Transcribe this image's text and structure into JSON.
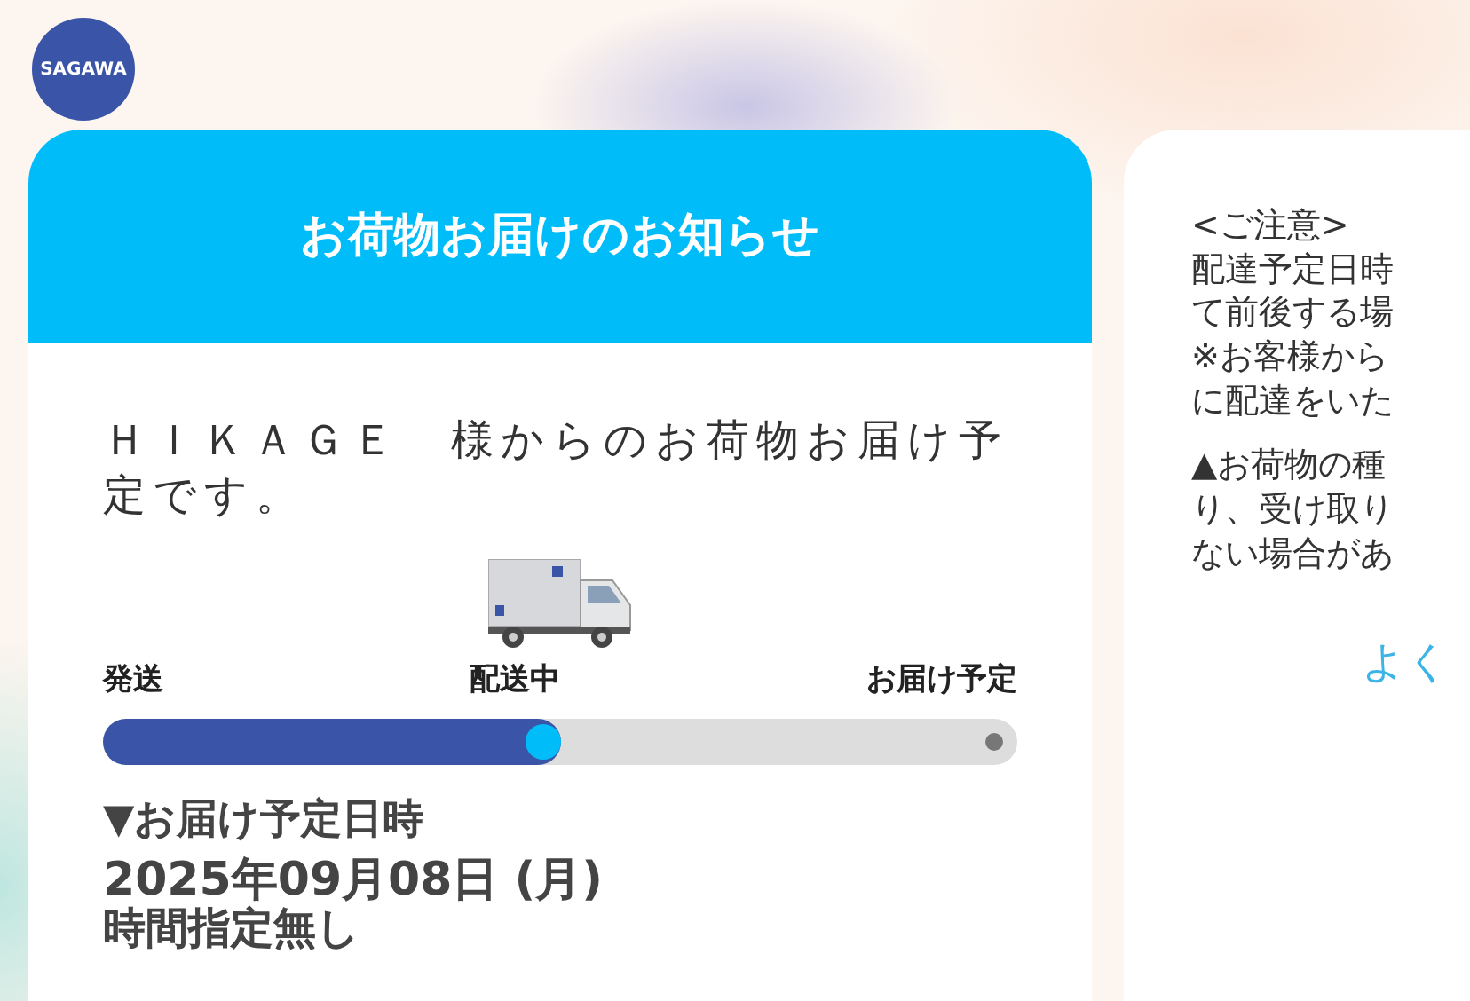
{
  "logo": {
    "text": "SAGAWA"
  },
  "main_card": {
    "title": "お荷物お届けのお知らせ",
    "message": "ＨＩＫＡＧＥ　様からのお荷物お届け予定です。",
    "progress": {
      "steps": [
        {
          "label": "発送"
        },
        {
          "label": "配送中"
        },
        {
          "label": "お届け予定"
        }
      ],
      "level": 0.5
    },
    "delivery_heading": "▼お届け予定日時",
    "delivery_date": "2025年09月08日 (月)",
    "delivery_time": "時間指定無し"
  },
  "notice_card": {
    "paragraphs": [
      [
        "<ご注意>",
        "配達予定日時",
        "て前後する場",
        "※お客様から",
        "に配達をいた"
      ],
      [
        "▲お荷物の種",
        "り、受け取り",
        "ない場合があ"
      ]
    ],
    "link": "よく"
  }
}
